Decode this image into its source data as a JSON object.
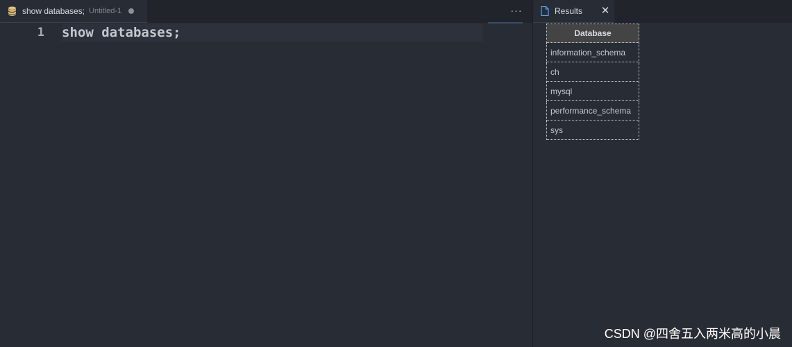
{
  "editor": {
    "tab": {
      "title": "show databases;",
      "description": "Untitled-1",
      "icon": "database-icon",
      "icon_color": "#e5c07b"
    },
    "more_actions_label": "···",
    "gutter": {
      "line_number": "1"
    },
    "code": "show databases;"
  },
  "results": {
    "tab": {
      "label": "Results",
      "icon": "file-icon",
      "close_label": "✕"
    },
    "table": {
      "header": "Database",
      "rows": [
        "information_schema",
        "ch",
        "mysql",
        "performance_schema",
        "sys"
      ]
    }
  },
  "watermark": "CSDN @四舍五入两米高的小晨"
}
